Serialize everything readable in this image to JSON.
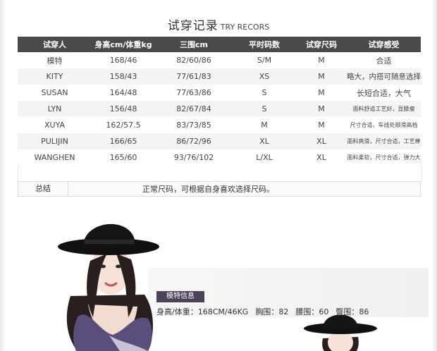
{
  "title": {
    "cn": "试穿记录",
    "en": "TRY RECORS"
  },
  "table": {
    "headers": [
      "试穿人",
      "身高cm/体重kg",
      "三围cm",
      "平时码数",
      "试穿尺码",
      "试穿感受"
    ],
    "rows": [
      [
        "模特",
        "168/46",
        "82/60/86",
        "S/M",
        "M",
        "合适"
      ],
      [
        "KITY",
        "158/43",
        "77/61/83",
        "XS",
        "M",
        "略大，内搭可随意选择"
      ],
      [
        "SUSAN",
        "164/48",
        "77/63/86",
        "S",
        "M",
        "长短合适，大气"
      ],
      [
        "LYN",
        "156/48",
        "82/67/84",
        "S",
        "M",
        "面料舒适工艺好，显腰瘦"
      ],
      [
        "XUYA",
        "162/57.5",
        "83/73/85",
        "M",
        "M",
        "尺寸合适，车线处顺滑高档"
      ],
      [
        "PULIJIN",
        "166/65",
        "86/72/96",
        "XL",
        "XL",
        "面料爽滑，尺寸合适，工艺棒"
      ],
      [
        "WANGHEN",
        "165/60",
        "93/76/102",
        "L/XL",
        "XL",
        "面料柔软，尺寸合适，弹力大"
      ]
    ]
  },
  "summary": {
    "label": "总结",
    "text": "正常尺码，可根据自身喜欢选择尺码。"
  },
  "model_info": {
    "tag": "模特信息",
    "height_weight": "身高/体重：168CM/46KG",
    "bust": "胸围：82",
    "waist": "腰围：60",
    "hip": "臀围：86"
  },
  "colors": {
    "header_bg": "#4a4a4a",
    "tag_bg": "#4d4358",
    "fur": "#5a4f7a"
  }
}
